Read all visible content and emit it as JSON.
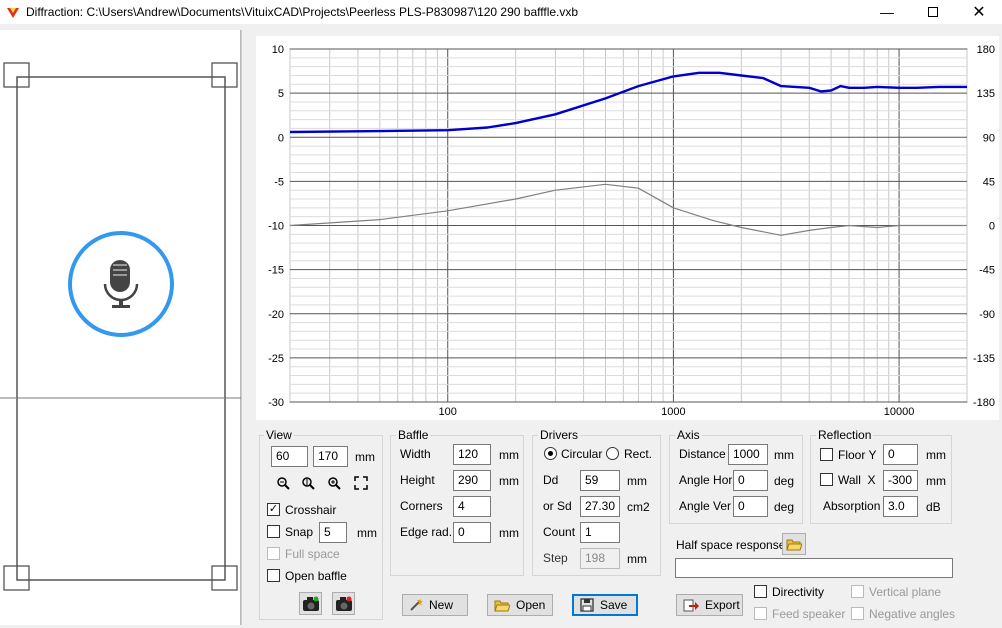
{
  "window": {
    "title": "Diffraction: C:\\Users\\Andrew\\Documents\\VituixCAD\\Projects\\Peerless PLS-P830987\\120 290 bafffle.vxb"
  },
  "view": {
    "title": "View",
    "width": "60",
    "depth": "170",
    "unit": "mm",
    "crosshair_label": "Crosshair",
    "crosshair_checked": "✓",
    "snap_label": "Snap",
    "snap_value": "5",
    "snap_unit": "mm",
    "full_space_label": "Full space",
    "open_baffle_label": "Open baffle"
  },
  "baffle": {
    "title": "Baffle",
    "width_label": "Width",
    "width": "120",
    "height_label": "Height",
    "height": "290",
    "corners_label": "Corners",
    "corners": "4",
    "edge_label": "Edge rad.",
    "edge": "0",
    "unit": "mm"
  },
  "drivers": {
    "title": "Drivers",
    "circular_label": "Circular",
    "rect_label": "Rect.",
    "dd_label": "Dd",
    "dd": "59",
    "dd_unit": "mm",
    "sd_label": "or Sd",
    "sd": "27.30",
    "sd_unit": "cm2",
    "count_label": "Count",
    "count": "1",
    "step_label": "Step",
    "step": "198",
    "step_unit": "mm"
  },
  "axis": {
    "title": "Axis",
    "distance_label": "Distance",
    "distance": "1000",
    "distance_unit": "mm",
    "hor_label": "Angle Hor",
    "hor": "0",
    "ver_label": "Angle Ver",
    "ver": "0",
    "deg": "deg"
  },
  "reflection": {
    "title": "Reflection",
    "floor_label": "Floor Y",
    "floor": "0",
    "wall_label": "Wall  X",
    "wall": "-300",
    "mm": "mm",
    "absorption_label": "Absorption",
    "absorption": "3.0",
    "db": "dB"
  },
  "half_space": {
    "label": "Half space response",
    "value": ""
  },
  "buttons": {
    "new": "New",
    "open": "Open",
    "save": "Save",
    "export": "Export"
  },
  "options": {
    "directivity": "Directivity",
    "vertical_plane": "Vertical plane",
    "feed_speaker": "Feed speaker",
    "negative_angles": "Negative angles"
  },
  "colors": {
    "spl": "#0000cc",
    "phase": "#808080",
    "mic_ring": "#3399ee"
  },
  "chart_data": {
    "type": "line",
    "xscale": "log",
    "xlim": [
      20,
      20000
    ],
    "ylim": [
      -30,
      10
    ],
    "y2lim": [
      -180,
      180
    ],
    "x_ticks": [
      "100",
      "1000",
      "10000"
    ],
    "y_ticks": [
      "10",
      "5",
      "0",
      "-5",
      "-10",
      "-15",
      "-20",
      "-25",
      "-30"
    ],
    "y2_ticks": [
      "180",
      "135",
      "90",
      "45",
      "0",
      "-45",
      "-90",
      "-135",
      "-180"
    ],
    "series": [
      {
        "axis": "left",
        "points": [
          [
            20,
            0.6
          ],
          [
            50,
            0.7
          ],
          [
            100,
            0.8
          ],
          [
            150,
            1.1
          ],
          [
            200,
            1.6
          ],
          [
            300,
            2.6
          ],
          [
            500,
            4.4
          ],
          [
            700,
            5.8
          ],
          [
            1000,
            6.9
          ],
          [
            1300,
            7.3
          ],
          [
            1600,
            7.3
          ],
          [
            2000,
            7.0
          ],
          [
            2500,
            6.7
          ],
          [
            3000,
            5.8
          ],
          [
            4000,
            5.6
          ],
          [
            4500,
            5.2
          ],
          [
            5000,
            5.3
          ],
          [
            5500,
            5.8
          ],
          [
            6000,
            5.6
          ],
          [
            7000,
            5.6
          ],
          [
            8000,
            5.7
          ],
          [
            10000,
            5.6
          ],
          [
            12000,
            5.6
          ],
          [
            15000,
            5.7
          ],
          [
            20000,
            5.7
          ]
        ]
      },
      {
        "axis": "right",
        "points": [
          [
            20,
            0
          ],
          [
            50,
            6
          ],
          [
            100,
            15
          ],
          [
            200,
            27
          ],
          [
            300,
            36
          ],
          [
            500,
            42
          ],
          [
            700,
            38
          ],
          [
            1000,
            18
          ],
          [
            1500,
            5
          ],
          [
            2000,
            -2
          ],
          [
            3000,
            -10
          ],
          [
            4000,
            -5
          ],
          [
            5000,
            -2
          ],
          [
            6000,
            0
          ],
          [
            8000,
            -2
          ],
          [
            10000,
            0
          ],
          [
            15000,
            0
          ],
          [
            20000,
            0
          ]
        ]
      }
    ]
  }
}
